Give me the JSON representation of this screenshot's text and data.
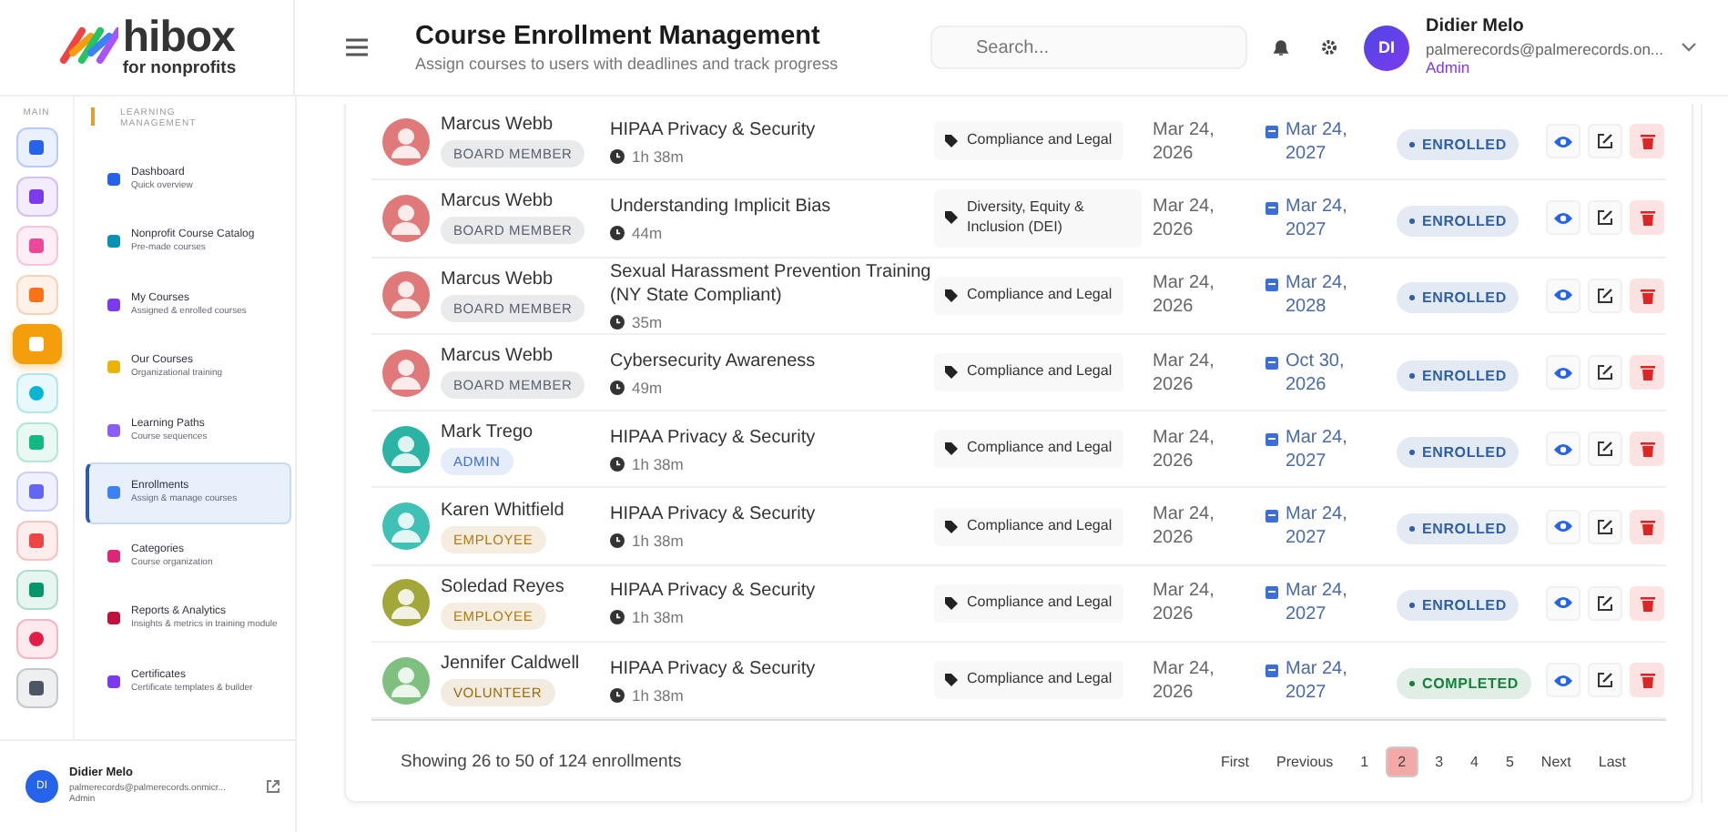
{
  "brand": {
    "name": "hibox",
    "tagline": "for nonprofits"
  },
  "header": {
    "title": "Course Enrollment Management",
    "subtitle": "Assign courses to users with deadlines and track progress",
    "search": {
      "placeholder": "Search..."
    },
    "user": {
      "initials": "DI",
      "name": "Didier Melo",
      "email": "palmerecords@palmerecords.on...",
      "role": "Admin"
    }
  },
  "rail": {
    "label": "MAIN",
    "items": [
      {
        "kind": "home",
        "color": "#2563eb",
        "selected": false
      },
      {
        "kind": "org",
        "color": "#7c3aed",
        "selected": false
      },
      {
        "kind": "hands",
        "color": "#ec4899",
        "selected": false
      },
      {
        "kind": "book",
        "color": "#f97316",
        "selected": false
      },
      {
        "kind": "cap",
        "color": "#f59e0b",
        "selected": true
      },
      {
        "kind": "dot",
        "color": "#06b6d4",
        "selected": false
      },
      {
        "kind": "nodes",
        "color": "#10b981",
        "selected": false
      },
      {
        "kind": "doc",
        "color": "#6366f1",
        "selected": false
      },
      {
        "kind": "person",
        "color": "#ef4444",
        "selected": false
      },
      {
        "kind": "team",
        "color": "#059669",
        "selected": false
      },
      {
        "kind": "pie",
        "color": "#e11d48",
        "selected": false
      },
      {
        "kind": "gear",
        "color": "#4b5563",
        "selected": false
      }
    ]
  },
  "nav": {
    "section": "LEARNING MANAGEMENT",
    "items": [
      {
        "title": "Dashboard",
        "subtitle": "Quick overview",
        "color": "#2563eb",
        "selected": false
      },
      {
        "title": "Nonprofit Course Catalog",
        "subtitle": "Pre-made courses",
        "color": "#0891b2",
        "selected": false
      },
      {
        "title": "My Courses",
        "subtitle": "Assigned & enrolled courses",
        "color": "#7c3aed",
        "selected": false
      },
      {
        "title": "Our Courses",
        "subtitle": "Organizational training",
        "color": "#eab308",
        "selected": false
      },
      {
        "title": "Learning Paths",
        "subtitle": "Course sequences",
        "color": "#8b5cf6",
        "selected": false
      },
      {
        "title": "Enrollments",
        "subtitle": "Assign & manage courses",
        "color": "#3b82f6",
        "selected": true
      },
      {
        "title": "Categories",
        "subtitle": "Course organization",
        "color": "#db2777",
        "selected": false
      },
      {
        "title": "Reports & Analytics",
        "subtitle": "Insights & metrics in training module",
        "color": "#be123c",
        "selected": false
      },
      {
        "title": "Certificates",
        "subtitle": "Certificate templates & builder",
        "color": "#7c3aed",
        "selected": false
      }
    ]
  },
  "sidebar_user": {
    "initials": "DI",
    "name": "Didier Melo",
    "email": "palmerecords@palmerecords.onmicr...",
    "role": "Admin"
  },
  "rows": [
    {
      "name": "Marcus Webb",
      "role": {
        "label": "BOARD MEMBER",
        "color": "#5a6270"
      },
      "avatar": {
        "color": "#e07a7a"
      },
      "course": "HIPAA Privacy & Security",
      "duration": "1h 38m",
      "category": "Compliance and Legal",
      "start": "Mar 24, 2026",
      "due": "Mar 24, 2027",
      "status": {
        "label": "ENROLLED",
        "color": "#2f5fa8"
      }
    },
    {
      "name": "Marcus Webb",
      "role": {
        "label": "BOARD MEMBER",
        "color": "#5a6270"
      },
      "avatar": {
        "color": "#e07a7a"
      },
      "course": "Understanding Implicit Bias",
      "duration": "44m",
      "category": "Diversity, Equity & Inclusion (DEI)",
      "start": "Mar 24, 2026",
      "due": "Mar 24, 2027",
      "status": {
        "label": "ENROLLED",
        "color": "#2f5fa8"
      }
    },
    {
      "name": "Marcus Webb",
      "role": {
        "label": "BOARD MEMBER",
        "color": "#5a6270"
      },
      "avatar": {
        "color": "#e07a7a"
      },
      "course": "Sexual Harassment Prevention Training (NY State Compliant)",
      "duration": "35m",
      "category": "Compliance and Legal",
      "start": "Mar 24, 2026",
      "due": "Mar 24, 2028",
      "status": {
        "label": "ENROLLED",
        "color": "#2f5fa8"
      }
    },
    {
      "name": "Marcus Webb",
      "role": {
        "label": "BOARD MEMBER",
        "color": "#5a6270"
      },
      "avatar": {
        "color": "#e07a7a"
      },
      "course": "Cybersecurity Awareness",
      "duration": "49m",
      "category": "Compliance and Legal",
      "start": "Mar 24, 2026",
      "due": "Oct 30, 2026",
      "status": {
        "label": "ENROLLED",
        "color": "#2f5fa8"
      }
    },
    {
      "name": "Mark Trego",
      "role": {
        "label": "ADMIN",
        "color": "#3b6fd6"
      },
      "avatar": {
        "color": "#2bb3a3"
      },
      "course": "HIPAA Privacy & Security",
      "duration": "1h 38m",
      "category": "Compliance and Legal",
      "start": "Mar 24, 2026",
      "due": "Mar 24, 2027",
      "status": {
        "label": "ENROLLED",
        "color": "#2f5fa8"
      }
    },
    {
      "name": "Karen Whitfield",
      "role": {
        "label": "EMPLOYEE",
        "color": "#b27a12"
      },
      "avatar": {
        "color": "#3fc1b5"
      },
      "course": "HIPAA Privacy & Security",
      "duration": "1h 38m",
      "category": "Compliance and Legal",
      "start": "Mar 24, 2026",
      "due": "Mar 24, 2027",
      "status": {
        "label": "ENROLLED",
        "color": "#2f5fa8"
      }
    },
    {
      "name": "Soledad Reyes",
      "role": {
        "label": "EMPLOYEE",
        "color": "#b27a12"
      },
      "avatar": {
        "color": "#a3a73a"
      },
      "course": "HIPAA Privacy & Security",
      "duration": "1h 38m",
      "category": "Compliance and Legal",
      "start": "Mar 24, 2026",
      "due": "Mar 24, 2027",
      "status": {
        "label": "ENROLLED",
        "color": "#2f5fa8"
      }
    },
    {
      "name": "Jennifer Caldwell",
      "role": {
        "label": "VOLUNTEER",
        "color": "#9a6b10"
      },
      "avatar": {
        "color": "#7fbf7f"
      },
      "course": "HIPAA Privacy & Security",
      "duration": "1h 38m",
      "category": "Compliance and Legal",
      "start": "Mar 24, 2026",
      "due": "Mar 24, 2027",
      "status": {
        "label": "COMPLETED",
        "color": "#17803d"
      }
    }
  ],
  "footer": {
    "summary": "Showing 26 to 50 of 124 enrollments",
    "pages": [
      {
        "label": "First",
        "selected": false
      },
      {
        "label": "Previous",
        "selected": false
      },
      {
        "label": "1",
        "selected": false
      },
      {
        "label": "2",
        "selected": true
      },
      {
        "label": "3",
        "selected": false
      },
      {
        "label": "4",
        "selected": false
      },
      {
        "label": "5",
        "selected": false
      },
      {
        "label": "Next",
        "selected": false
      },
      {
        "label": "Last",
        "selected": false
      }
    ]
  }
}
